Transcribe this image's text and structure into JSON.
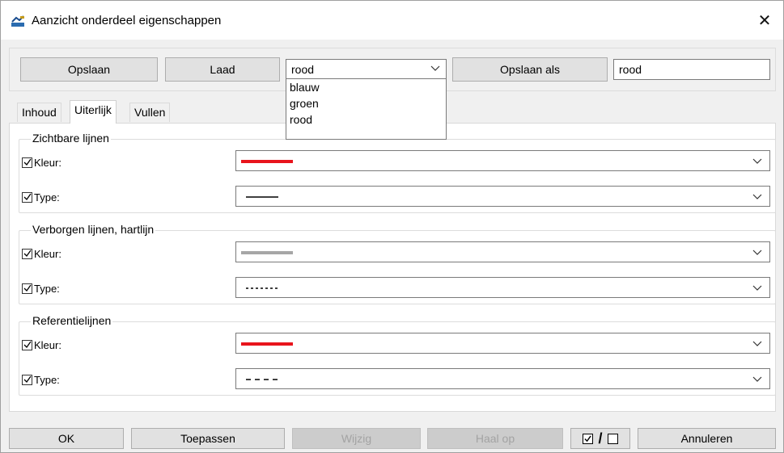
{
  "window": {
    "title": "Aanzicht onderdeel eigenschappen",
    "close_glyph": "✕"
  },
  "toolbar": {
    "save_label": "Opslaan",
    "load_label": "Laad",
    "preset_selected": "rood",
    "save_as_label": "Opslaan als",
    "save_as_name": "rood",
    "preset_options": [
      "blauw",
      "groen",
      "rood"
    ]
  },
  "tabs": [
    {
      "label": "Inhoud",
      "active": false
    },
    {
      "label": "Uiterlijk",
      "active": true
    },
    {
      "label": "Vullen",
      "active": false
    }
  ],
  "sections": [
    {
      "title": "Zichtbare lijnen",
      "color_label": "Kleur:",
      "color_checked": true,
      "color_value": "#e8141c",
      "type_label": "Type:",
      "type_checked": true,
      "line_type": "solid"
    },
    {
      "title": "Verborgen lijnen, hartlijn",
      "color_label": "Kleur:",
      "color_checked": true,
      "color_value": "#a6a6a6",
      "type_label": "Type:",
      "type_checked": true,
      "line_type": "dotted"
    },
    {
      "title": "Referentielijnen",
      "color_label": "Kleur:",
      "color_checked": true,
      "color_value": "#e8141c",
      "type_label": "Type:",
      "type_checked": true,
      "line_type": "dashed"
    }
  ],
  "footer": {
    "ok_label": "OK",
    "apply_label": "Toepassen",
    "modify_label": "Wijzig",
    "fetch_label": "Haal op",
    "toggle_separator": "/",
    "cancel_label": "Annuleren"
  },
  "icons": {
    "app": "part-view-icon",
    "dropdown": "chevron-down-icon",
    "check": "checkmark-icon"
  }
}
